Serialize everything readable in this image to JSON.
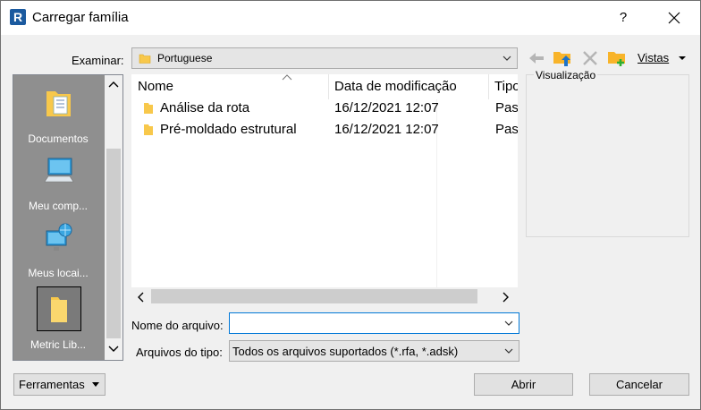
{
  "window": {
    "title": "Carregar família",
    "help_label": "?"
  },
  "toolbar": {
    "lookin_label": "Examinar:",
    "lookin_value": "Portuguese",
    "views_label": "Vistas",
    "icons": [
      "back-arrow-icon",
      "up-folder-icon",
      "delete-icon",
      "new-folder-icon"
    ]
  },
  "places": [
    {
      "label": "Documentos",
      "icon": "documents-icon"
    },
    {
      "label": "Meu comp...",
      "icon": "computer-icon"
    },
    {
      "label": "Meus locai...",
      "icon": "network-icon"
    },
    {
      "label": "Metric Lib...",
      "icon": "folder-icon",
      "selected": true
    }
  ],
  "filelist": {
    "columns": [
      "Nome",
      "Data de modificação",
      "Tipo"
    ],
    "rows": [
      {
        "name": "Análise da rota",
        "date": "16/12/2021 12:07",
        "type": "Past"
      },
      {
        "name": "Pré-moldado estrutural",
        "date": "16/12/2021 12:07",
        "type": "Past"
      }
    ]
  },
  "preview": {
    "label": "Visualização"
  },
  "form": {
    "filename_label": "Nome do arquivo:",
    "filename_value": "",
    "filetype_label": "Arquivos do tipo:",
    "filetype_value": "Todos os arquivos suportados  (*.rfa, *.adsk)"
  },
  "buttons": {
    "tools": "Ferramentas",
    "open": "Abrir",
    "cancel": "Cancelar"
  },
  "colors": {
    "accent": "#0078d7",
    "folder": "#f8c84b",
    "places_bg": "#8f8f8f"
  }
}
